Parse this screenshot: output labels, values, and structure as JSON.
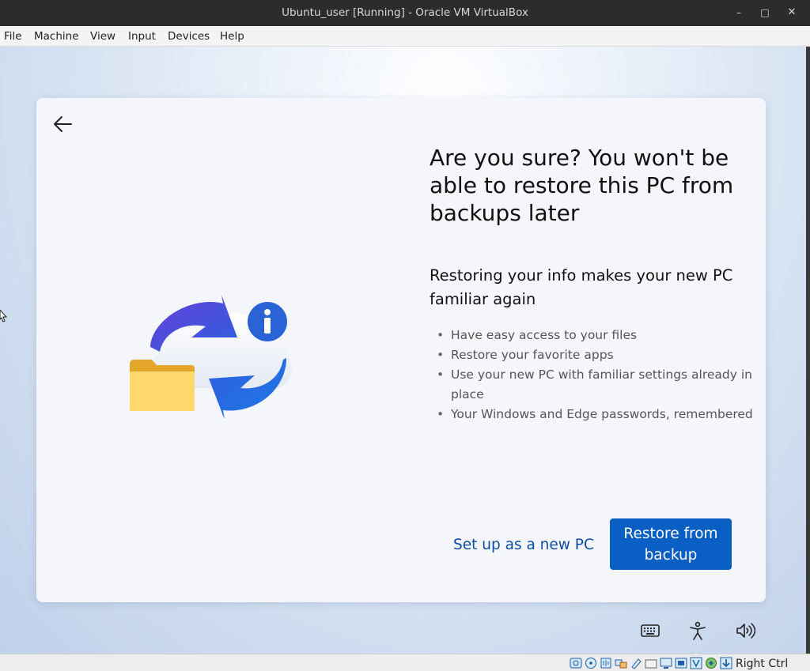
{
  "window": {
    "title": "Ubuntu_user [Running] - Oracle VM VirtualBox",
    "controls": {
      "minimize": "–",
      "maximize": "□",
      "close": "✕"
    }
  },
  "menu": [
    "File",
    "Machine",
    "View",
    "Input",
    "Devices",
    "Help"
  ],
  "oobe": {
    "heading": "Are you sure? You won't be able to restore this PC from backups later",
    "subheading": "Restoring your info makes your new PC familiar again",
    "bullets": [
      "Have easy access to your files",
      "Restore your favorite apps",
      "Use your new PC with familiar settings already in place",
      "Your Windows and Edge passwords, remembered"
    ],
    "secondary_button": "Set up as a new PC",
    "primary_button": "Restore from backup",
    "icons": {
      "back": "back-arrow-icon",
      "illustration": "backup-restore-illustration",
      "tray": [
        "keyboard-icon",
        "accessibility-icon",
        "volume-icon"
      ]
    }
  },
  "statusbar": {
    "host_key": "Right Ctrl",
    "icons": [
      "hard-disk-icon",
      "optical-drive-icon",
      "audio-icon",
      "network-icon",
      "usb-icon",
      "shared-folders-icon",
      "display-icon",
      "recording-icon",
      "virtualization-icon",
      "mouse-integration-icon",
      "host-key-arrow-icon"
    ]
  },
  "colors": {
    "titlebar": "#2c2c2c",
    "primary": "#0a5fc4",
    "link": "#0a4ea8"
  }
}
